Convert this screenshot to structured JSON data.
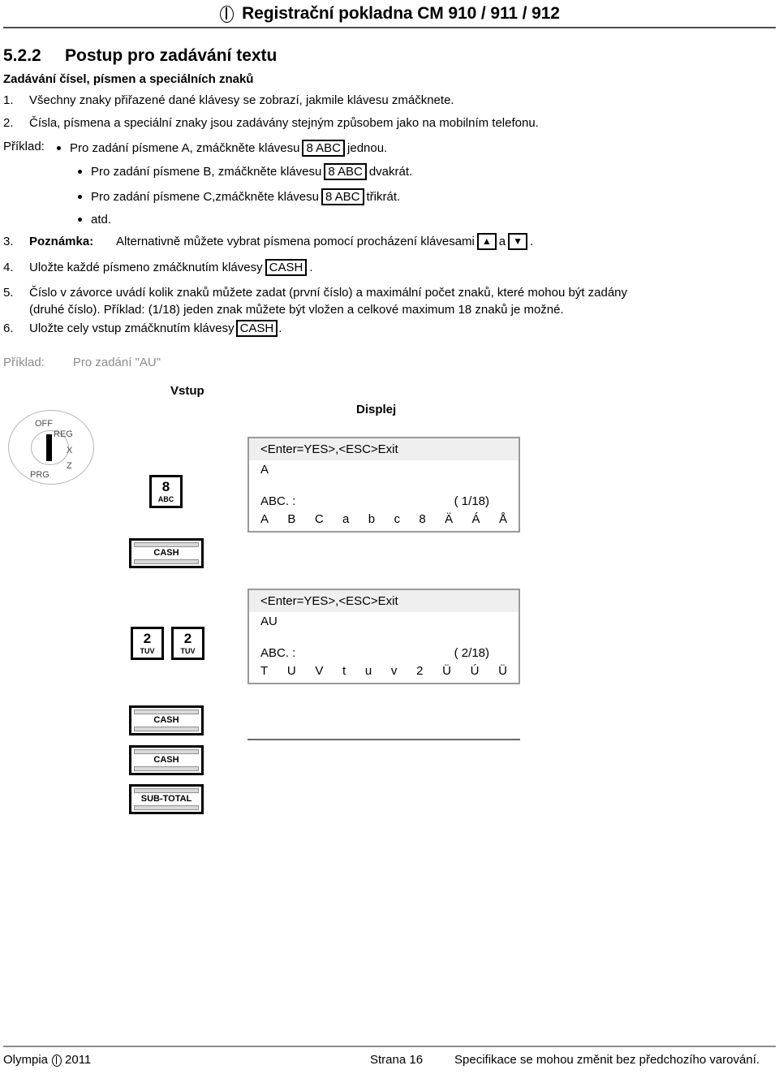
{
  "header": {
    "logo_icon": "olympia-logo-icon",
    "title": "Registrační pokladna CM 910 / 911 / 912"
  },
  "section": {
    "number": "5.2.2",
    "title": "Postup pro zadávání textu",
    "subtitle": "Zadávání čísel, písmen a speciálních znaků"
  },
  "steps": [
    {
      "index": "1.",
      "text": "Všechny znaky přiřazené dané klávesy se zobrazí, jakmile klávesu zmáčknete."
    },
    {
      "index": "2.",
      "text": "Čísla, písmena a speciální znaky jsou zadávány stejným způsobem jako na mobilním telefonu."
    }
  ],
  "example_block": {
    "label": "Příklad:",
    "bullets": [
      {
        "before": "Pro zadání písmene A, zmáčkněte klávesu",
        "key": "8 ABC",
        "after": "jednou."
      },
      {
        "before": "Pro zadání písmene B, zmáčkněte klávesu",
        "key": "8 ABC",
        "after": "dvakrát."
      },
      {
        "before": "Pro zadání písmene C,zmáčkněte klávesu",
        "key": "8 ABC",
        "after": "třikrát."
      },
      {
        "before": "atd.",
        "key": "",
        "after": ""
      }
    ]
  },
  "steps_cont": [
    {
      "index": "3.",
      "bold_lead": "Poznámka:",
      "text": "Alternativně můžete vybrat písmena pomocí procházení klávesami",
      "key_up": "▲",
      "conj": "a",
      "key_down": "▼",
      "tail": "."
    },
    {
      "index": "4.",
      "before": "Uložte každé písmeno zmáčknutím klávesy",
      "key": "CASH",
      "after": "."
    },
    {
      "index": "5.",
      "line1": "Číslo v závorce uvádí kolik znaků můžete zadat (první číslo) a maximální počet znaků, které mohou být zadány",
      "line2": "(druhé číslo). Příklad: (1/18) jeden znak můžete být vložen a celkové maximum 18 znaků je možné."
    },
    {
      "index": "6.",
      "before": "Uložte cely vstup zmáčknutím klávesy",
      "key": "CASH",
      "after": "."
    }
  ],
  "walkthrough": {
    "intro_label": "Příklad:",
    "intro_text": "Pro zadání \"AU\"",
    "column_input": "Vstup",
    "column_display": "Displej",
    "dial": {
      "icon": "mode-dial-icon",
      "positions": [
        "OFF",
        "REG",
        "X",
        "Z",
        "PRG"
      ]
    },
    "keys": [
      {
        "name": "key-8-abc",
        "big": "8",
        "sub": "ABC"
      },
      {
        "name": "key-cash-1",
        "label": "CASH"
      },
      {
        "name": "key-2-tuv-a",
        "big": "2",
        "sub": "TUV"
      },
      {
        "name": "key-2-tuv-b",
        "big": "2",
        "sub": "TUV"
      },
      {
        "name": "key-cash-2",
        "label": "CASH"
      },
      {
        "name": "key-cash-3",
        "label": "CASH"
      },
      {
        "name": "key-sub-total",
        "label": "SUB-TOTAL"
      }
    ],
    "displays": [
      {
        "head": "<Enter=YES>,<ESC>Exit",
        "entry": "A",
        "prompt": "ABC. :",
        "counter": "(  1/18)",
        "chars": [
          "A",
          "B",
          "C",
          "a",
          "b",
          "c",
          "8",
          "Ä",
          "Á",
          "Å"
        ]
      },
      {
        "head": "<Enter=YES>,<ESC>Exit",
        "entry": "AU",
        "prompt": "ABC. :",
        "counter": "(  2/18)",
        "chars": [
          "T",
          "U",
          "V",
          "t",
          "u",
          "v",
          "2",
          "Ü",
          "Ú",
          "Ü"
        ]
      }
    ]
  },
  "footer": {
    "left_brand": "Olympia",
    "left_year": "2011",
    "logo_icon": "olympia-logo-icon",
    "page": "Strana 16",
    "notice": "Specifikace se mohou změnit bez předchozího varování."
  }
}
